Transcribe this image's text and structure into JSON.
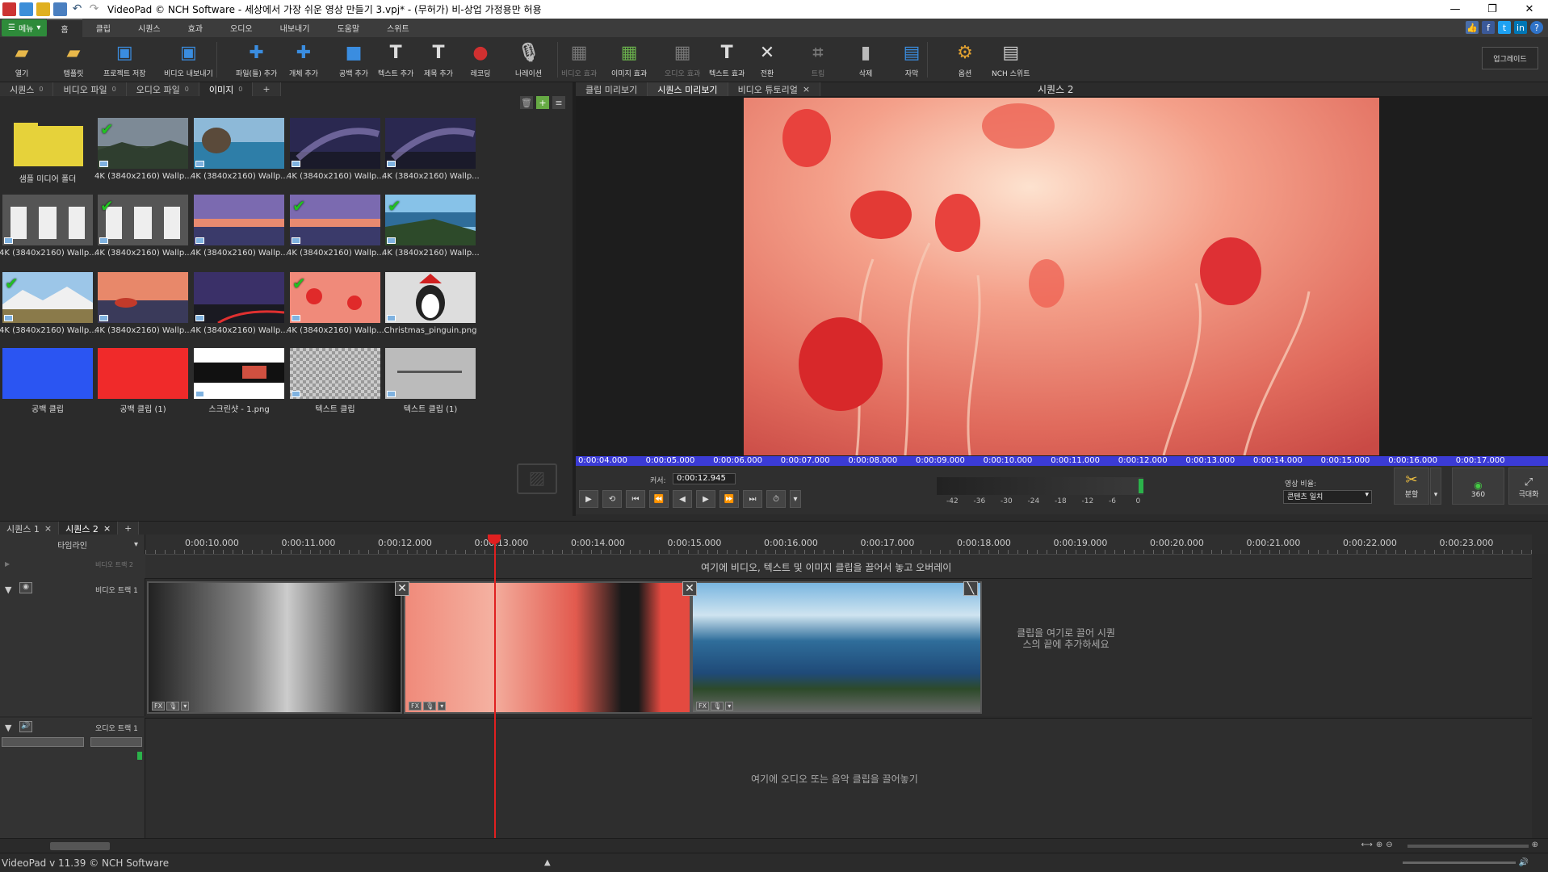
{
  "window": {
    "title": "VideoPad © NCH Software - 세상에서 가장 쉬운 영상 만들기 3.vpj* - (무허가) 비-상업 가정용만 허용",
    "min": "—",
    "max": "❐",
    "close": "✕"
  },
  "menu": {
    "menu_button": "메뉴",
    "tabs": [
      "홈",
      "클립",
      "시퀀스",
      "효과",
      "오디오",
      "내보내기",
      "도움말",
      "스위트"
    ]
  },
  "toolbar": {
    "items": [
      {
        "label": "열기",
        "icon": "folder-open-icon"
      },
      {
        "label": "템플릿",
        "icon": "template-icon"
      },
      {
        "label": "프로젝트 저장",
        "icon": "save-icon"
      },
      {
        "label": "비디오 내보내기",
        "icon": "export-video-icon"
      },
      {
        "label": "파일(들) 추가",
        "icon": "add-files-icon"
      },
      {
        "label": "개체 추가",
        "icon": "add-object-icon"
      },
      {
        "label": "공백 추가",
        "icon": "add-blank-icon"
      },
      {
        "label": "텍스트 추가",
        "icon": "add-text-icon"
      },
      {
        "label": "제목 추가",
        "icon": "add-title-icon"
      },
      {
        "label": "레코딩",
        "icon": "record-icon"
      },
      {
        "label": "나레이션",
        "icon": "microphone-icon"
      },
      {
        "label": "비디오 효과",
        "icon": "video-effects-icon",
        "disabled": true
      },
      {
        "label": "이미지 효과",
        "icon": "image-effects-icon"
      },
      {
        "label": "오디오 효과",
        "icon": "audio-effects-icon",
        "disabled": true
      },
      {
        "label": "텍스트 효과",
        "icon": "text-effects-icon"
      },
      {
        "label": "전환",
        "icon": "transition-icon"
      },
      {
        "label": "트림",
        "icon": "trim-icon",
        "disabled": true
      },
      {
        "label": "삭제",
        "icon": "delete-icon"
      },
      {
        "label": "자막",
        "icon": "subtitle-icon"
      },
      {
        "label": "옵션",
        "icon": "options-icon"
      },
      {
        "label": "NCH 스위트",
        "icon": "nch-suite-icon"
      }
    ],
    "upgrade": "업그레이드"
  },
  "bin": {
    "tabs": [
      {
        "label": "시퀀스",
        "count": "0"
      },
      {
        "label": "비디오 파일",
        "count": "0"
      },
      {
        "label": "오디오 파일",
        "count": "0"
      },
      {
        "label": "이미지",
        "count": "0"
      }
    ],
    "items": [
      {
        "label": "샘플 미디어 폴더",
        "kind": "folder"
      },
      {
        "label": "4K (3840x2160) Wallp...",
        "kind": "storm",
        "checked": true
      },
      {
        "label": "4K (3840x2160) Wallp...",
        "kind": "sea-rock",
        "checked": false
      },
      {
        "label": "4K (3840x2160) Wallp...",
        "kind": "milkyway",
        "checked": false
      },
      {
        "label": "4K (3840x2160) Wallp...",
        "kind": "milkyway",
        "checked": false
      },
      {
        "label": "4K (3840x2160) Wallp...",
        "kind": "arches",
        "checked": false
      },
      {
        "label": "4K (3840x2160) Wallp...",
        "kind": "arches",
        "checked": true
      },
      {
        "label": "4K (3840x2160) Wallp...",
        "kind": "dusk-lake",
        "checked": false
      },
      {
        "label": "4K (3840x2160) Wallp...",
        "kind": "dusk-lake",
        "checked": true
      },
      {
        "label": "4K (3840x2160) Wallp...",
        "kind": "coast",
        "checked": true
      },
      {
        "label": "4K (3840x2160) Wallp...",
        "kind": "mountain-snow",
        "checked": true
      },
      {
        "label": "4K (3840x2160) Wallp...",
        "kind": "sunset-lake",
        "checked": false
      },
      {
        "label": "4K (3840x2160) Wallp...",
        "kind": "night-road",
        "checked": false
      },
      {
        "label": "4K (3840x2160) Wallp...",
        "kind": "poppies",
        "checked": true
      },
      {
        "label": "Christmas_pinguin.png",
        "kind": "penguin",
        "checked": false
      },
      {
        "label": "공백 클립",
        "kind": "blue",
        "checked": false
      },
      {
        "label": "공백 클립 (1)",
        "kind": "red",
        "checked": false
      },
      {
        "label": "스크린샷 - 1.png",
        "kind": "screenshot",
        "checked": false
      },
      {
        "label": "텍스트 클립",
        "kind": "text",
        "checked": false
      },
      {
        "label": "텍스트 클립 (1)",
        "kind": "text2",
        "checked": false
      }
    ]
  },
  "preview": {
    "tabs": [
      {
        "label": "클립 미리보기"
      },
      {
        "label": "시퀀스 미리보기"
      },
      {
        "label": "비디오 튜토리얼",
        "close": "×"
      }
    ],
    "sequence_title": "시퀀스 2",
    "ruler": [
      "0:00:04.000",
      "0:00:05.000",
      "0:00:06.000",
      "0:00:07.000",
      "0:00:08.000",
      "0:00:09.000",
      "0:00:10.000",
      "0:00:11.000",
      "0:00:12.000",
      "0:00:13.000",
      "0:00:14.000",
      "0:00:15.000",
      "0:00:16.000",
      "0:00:17.000"
    ],
    "cursor_label": "커서:",
    "cursor_value": "0:00:12.945",
    "meter_scale": [
      "-42",
      "-36",
      "-30",
      "-24",
      "-18",
      "-12",
      "-6",
      "0"
    ],
    "aspect_label": "영상 비율:",
    "aspect_value": "콘텐츠 일치",
    "split_label": "분할",
    "vr_label": "360",
    "fullscreen_label": "극대화"
  },
  "sequence_tabs": [
    {
      "label": "시퀀스 1",
      "close": "×"
    },
    {
      "label": "시퀀스 2",
      "close": "×"
    },
    {
      "label": "+"
    }
  ],
  "timeline": {
    "mode": "타임라인",
    "ruler": [
      "0:00:10.000",
      "0:00:11.000",
      "0:00:12.000",
      "0:00:13.000",
      "0:00:14.000",
      "0:00:15.000",
      "0:00:16.000",
      "0:00:17.000",
      "0:00:18.000",
      "0:00:19.000",
      "0:00:20.000",
      "0:00:21.000",
      "0:00:22.000",
      "0:00:23.000"
    ],
    "overlay_track": "비디오 트랙 2",
    "overlay_msg": "여기에 비디오, 텍스트 및 이미지 클립을 끌어서 놓고 오버레이",
    "video_track": "비디오 트랙 1",
    "video_msg": "클립을 여기로 끌어 시퀀스의 끝에 추가하세요",
    "audio_track": "오디오 트랙 1",
    "audio_msg": "여기에 오디오 또는 음악 클립을 끌어놓기",
    "fx_label": "FX"
  },
  "status": {
    "text": "VideoPad v 11.39 © NCH Software"
  },
  "colors": {
    "accent_green": "#2e8b3a",
    "ruler_blue": "#3b3bd6",
    "playhead_red": "#e02020"
  }
}
